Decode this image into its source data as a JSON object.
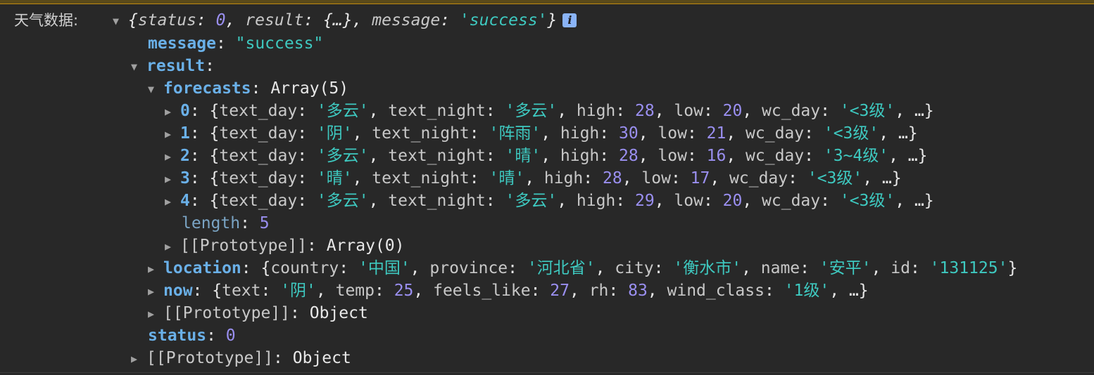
{
  "label": "天气数据:",
  "summary": {
    "status_key": "status",
    "status_value": "0",
    "result_key": "result",
    "result_value": "{…}",
    "message_key": "message",
    "message_value": "'success'"
  },
  "message": {
    "key": "message",
    "value": "\"success\""
  },
  "result": {
    "key": "result",
    "forecasts": {
      "key": "forecasts",
      "type": "Array(5)",
      "items": [
        {
          "index": "0",
          "text_day": "'多云'",
          "text_night": "'多云'",
          "high": "28",
          "low": "20",
          "wc_day": "'<3级'"
        },
        {
          "index": "1",
          "text_day": "'阴'",
          "text_night": "'阵雨'",
          "high": "30",
          "low": "21",
          "wc_day": "'<3级'"
        },
        {
          "index": "2",
          "text_day": "'多云'",
          "text_night": "'晴'",
          "high": "28",
          "low": "16",
          "wc_day": "'3~4级'"
        },
        {
          "index": "3",
          "text_day": "'晴'",
          "text_night": "'晴'",
          "high": "28",
          "low": "17",
          "wc_day": "'<3级'"
        },
        {
          "index": "4",
          "text_day": "'多云'",
          "text_night": "'多云'",
          "high": "29",
          "low": "20",
          "wc_day": "'<3级'"
        }
      ],
      "length_key": "length",
      "length_value": "5",
      "prototype_key": "[[Prototype]]",
      "prototype_value": "Array(0)"
    },
    "location": {
      "key": "location",
      "country": "'中国'",
      "province": "'河北省'",
      "city": "'衡水市'",
      "name": "'安平'",
      "id": "'131125'"
    },
    "now": {
      "key": "now",
      "text": "'阴'",
      "temp": "25",
      "feels_like": "27",
      "rh": "83",
      "wind_class": "'1级'"
    },
    "prototype_key": "[[Prototype]]",
    "prototype_value": "Object"
  },
  "status": {
    "key": "status",
    "value": "0"
  },
  "prototype": {
    "key": "[[Prototype]]",
    "value": "Object"
  },
  "ellipsis": "…",
  "icons": {
    "expanded": "▼",
    "collapsed": "▶",
    "info": "i"
  }
}
